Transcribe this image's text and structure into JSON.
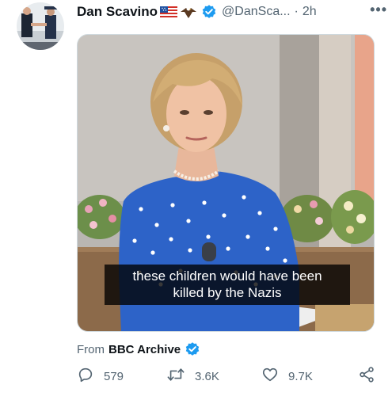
{
  "tweet": {
    "author_name": "Dan Scavino",
    "author_handle": "@DanSca...",
    "separator": "·",
    "time": "2h",
    "more_icon": "more-horizontal-icon",
    "flag_emoji": "us-flag-emoji",
    "eagle_emoji": "eagle-emoji"
  },
  "media": {
    "subtitle_line1": "these children would have been",
    "subtitle_line2": "killed by the Nazis"
  },
  "from": {
    "prefix": "From",
    "source": "BBC Archive"
  },
  "actions": {
    "replies": "579",
    "retweets": "3.6K",
    "likes": "9.7K"
  },
  "colors": {
    "verified_blue": "#1d9bf0",
    "secondary_text": "#536471",
    "primary_text": "#0f1419"
  }
}
